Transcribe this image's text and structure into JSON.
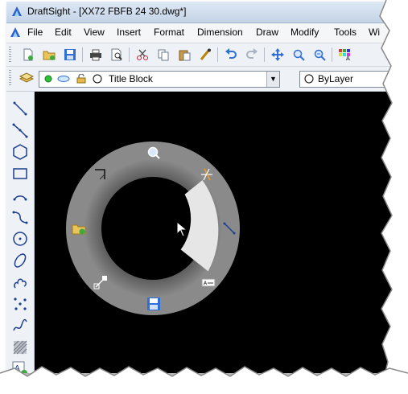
{
  "window": {
    "title": "DraftSight - [XX72 FBFB 24 30.dwg*]"
  },
  "menu": [
    "File",
    "Edit",
    "View",
    "Insert",
    "Format",
    "Dimension",
    "Draw",
    "Modify",
    "Tools",
    "Wi"
  ],
  "toolbar": {
    "icons": [
      "new-icon",
      "open-icon",
      "save-icon",
      "print-icon",
      "print-preview-icon",
      "cut-icon",
      "copy-icon",
      "paste-icon",
      "match-properties-icon",
      "undo-icon",
      "redo-icon",
      "pan-icon",
      "zoom-icon",
      "zoom-previous-icon",
      "layers-palette-icon"
    ]
  },
  "layer_bar": {
    "current_layer": "Title Block",
    "color_value": "ByLayer"
  },
  "left_toolbar": {
    "tools": [
      "line-icon",
      "polyline-icon",
      "polygon-icon",
      "rectangle-icon",
      "arc-icon",
      "spline-icon",
      "circle-icon",
      "ellipse-icon",
      "revision-cloud-icon",
      "point-icon",
      "freehand-icon",
      "hatch-icon",
      "note-icon"
    ]
  },
  "radial_menu": {
    "items": [
      "zoom-icon",
      "trim-icon",
      "line-icon",
      "note-icon",
      "save-icon",
      "stretch-icon",
      "open-folder-icon",
      "corner-icon"
    ],
    "highlighted": "line-icon"
  },
  "colors": {
    "canvas": "#000000",
    "ring": "#6e6e6e",
    "ring_highlight": "#e8e8e8",
    "accent_blue": "#2f6fd6"
  }
}
